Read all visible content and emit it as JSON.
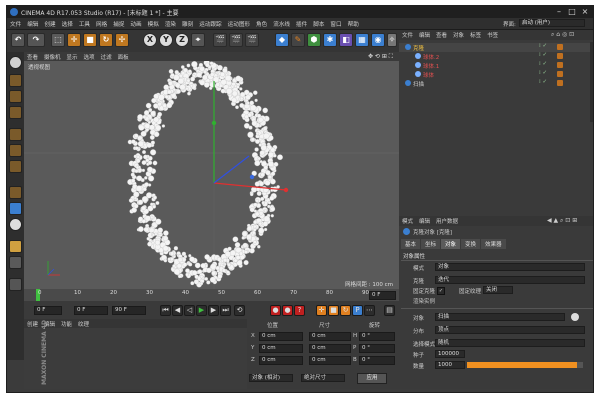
{
  "title": "CINEMA 4D R17.053 Studio (R17) - [未标题 1 *] - 主要",
  "interface_label": "界面:",
  "interface_value": "启动 (用户)",
  "menu": [
    "文件",
    "编辑",
    "创建",
    "选择",
    "工具",
    "网格",
    "捕捉",
    "动画",
    "模拟",
    "渲染",
    "雕刻",
    "运动跟踪",
    "运动图形",
    "角色",
    "流水线",
    "插件",
    "脚本",
    "窗口",
    "帮助"
  ],
  "toolbar": {
    "undo": "↶",
    "redo": "↷",
    "axis_x": "X",
    "axis_y": "Y",
    "axis_z": "Z"
  },
  "viewport": {
    "menu": [
      "查看",
      "摄像机",
      "显示",
      "选项",
      "过滤",
      "面板"
    ],
    "label": "透视视图",
    "grid_info": "网格间距 : 100 cm"
  },
  "timeline": {
    "ticks": [
      "0",
      "10",
      "20",
      "30",
      "40",
      "50",
      "60",
      "70",
      "80",
      "90"
    ],
    "end_frame": "0 F"
  },
  "transport": {
    "start": "0 F",
    "current": "0 F",
    "end": "90 F",
    "max": "90 F"
  },
  "material_menu": [
    "创建",
    "编辑",
    "功能",
    "纹理"
  ],
  "logo": "MAXON CINEMA 4D",
  "coords": {
    "headers": [
      "位置",
      "尺寸",
      "旋转"
    ],
    "rows": [
      {
        "axis": "X",
        "pos": "0 cm",
        "size": "0 cm",
        "rot_axis": "H",
        "rot": "0 °"
      },
      {
        "axis": "Y",
        "pos": "0 cm",
        "size": "0 cm",
        "rot_axis": "P",
        "rot": "0 °"
      },
      {
        "axis": "Z",
        "pos": "0 cm",
        "size": "0 cm",
        "rot_axis": "B",
        "rot": "0 °"
      }
    ],
    "mode": "对象 (相对)",
    "size_mode": "绝对尺寸",
    "apply": "应用"
  },
  "objects": {
    "menu": [
      "文件",
      "编辑",
      "查看",
      "对象",
      "标签",
      "书签"
    ],
    "items": [
      {
        "name": "克隆",
        "indent": 0,
        "color": "#f0c040"
      },
      {
        "name": "球体.2",
        "indent": 1,
        "color": "#e05050"
      },
      {
        "name": "球体.1",
        "indent": 1,
        "color": "#e05050"
      },
      {
        "name": "球体",
        "indent": 1,
        "color": "#e05050"
      },
      {
        "name": "扫描",
        "indent": 0,
        "color": "#cfcfcf"
      }
    ]
  },
  "attributes": {
    "menu": [
      "模式",
      "编辑",
      "用户数据"
    ],
    "object_title": "克隆对象 [克隆]",
    "tabs": [
      "基本",
      "坐标",
      "对象",
      "变换",
      "效果器"
    ],
    "active_tab": "对象",
    "section": "对象属性",
    "mode_label": "模式",
    "mode_value": "对象",
    "clone_label": "克隆",
    "clone_value": "迭代",
    "fixed_clone": "固定克隆",
    "fixed_texture": "固定纹理",
    "fixed_texture_value": "关闭",
    "render_instances": "渲染实例",
    "object_label": "对象",
    "object_value": "扫描",
    "distribution_label": "分布",
    "distribution_value": "顶点",
    "select_mode_label": "选择模式",
    "select_mode_value": "随机",
    "seed_label": "种子",
    "seed_value": "100000",
    "count_label": "数量",
    "count_value": "1000",
    "count_fraction": 0.95
  },
  "colors": {
    "accent": "#f09020",
    "viewport_bg": "#5a5a5a"
  }
}
